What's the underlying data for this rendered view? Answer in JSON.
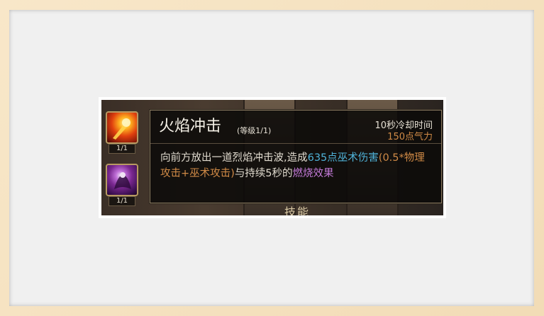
{
  "skills": [
    {
      "icon": "fire-blast-icon",
      "count": "1/1"
    },
    {
      "icon": "dark-crow-icon",
      "count": "1/1"
    }
  ],
  "tooltip": {
    "title": "火焰冲击",
    "level": "(等级1/1)",
    "cooldown": "10秒冷却时间",
    "cost": "150点气力",
    "desc": {
      "p1": "向前方放出一道烈焰冲击波,造成",
      "dmg": "635点巫术伤害",
      "formula": "(0.5*物理攻击+巫术攻击)",
      "p2": "与持续5秒的",
      "effect": "燃烧效果"
    }
  },
  "bottom_label": "技能",
  "colors": {
    "highlight_blue": "#4fb2d8",
    "highlight_orange": "#d08a46",
    "highlight_purple": "#c37ad8"
  }
}
